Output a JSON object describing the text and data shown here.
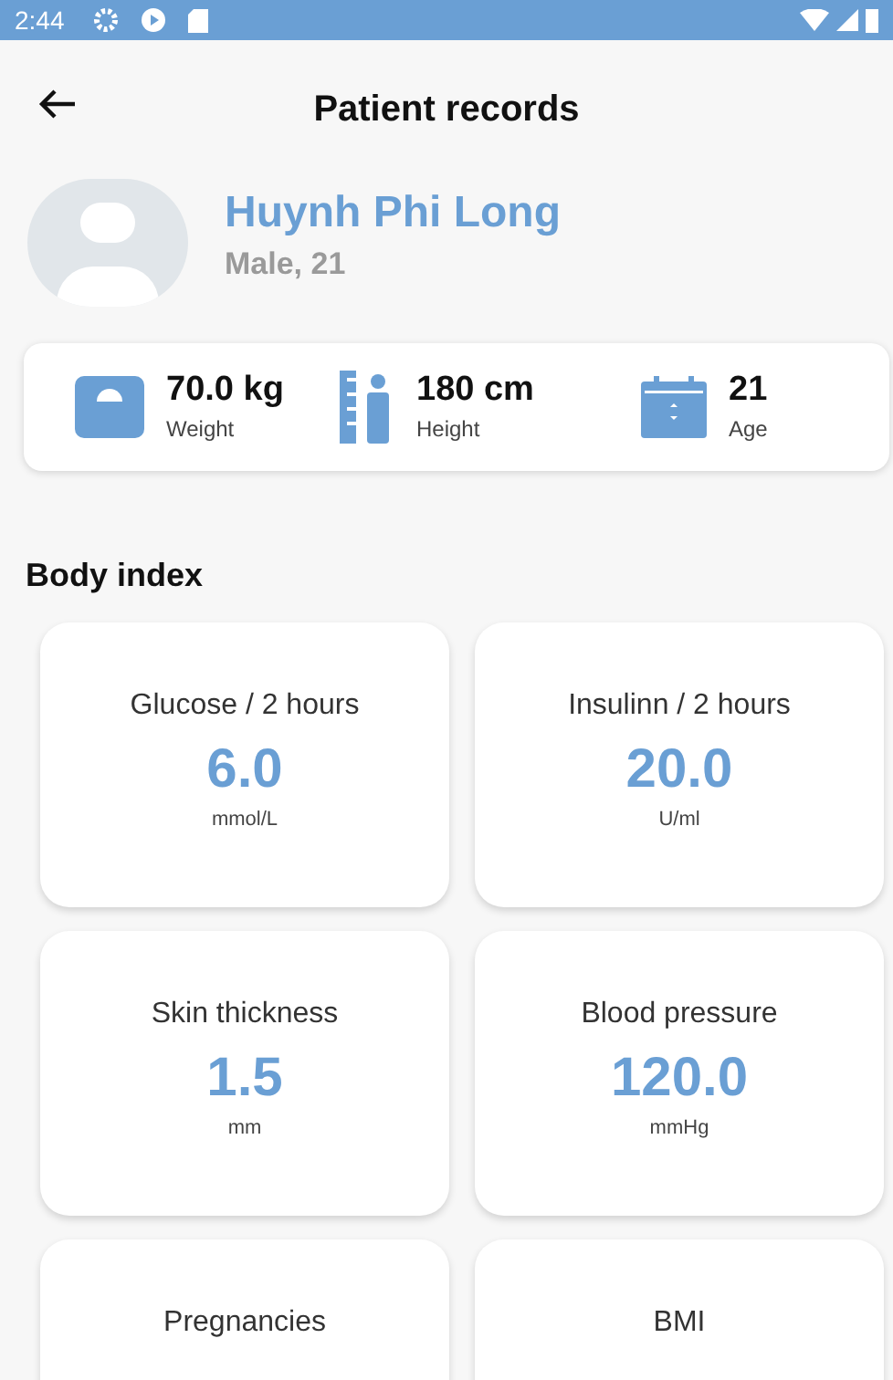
{
  "status_bar": {
    "time": "2:44"
  },
  "header": {
    "title": "Patient records"
  },
  "patient": {
    "name": "Huynh Phi Long",
    "details": "Male, 21"
  },
  "stats": [
    {
      "kind": "weight",
      "value": "70.0 kg",
      "label": "Weight"
    },
    {
      "kind": "height",
      "value": "180 cm",
      "label": "Height"
    },
    {
      "kind": "age",
      "value": "21",
      "label": "Age"
    }
  ],
  "body_index": {
    "title": "Body index",
    "cards": [
      {
        "label": "Glucose / 2 hours",
        "value": "6.0",
        "unit": "mmol/L"
      },
      {
        "label": "Insulinn / 2 hours",
        "value": "20.0",
        "unit": "U/ml"
      },
      {
        "label": "Skin thickness",
        "value": "1.5",
        "unit": "mm"
      },
      {
        "label": "Blood pressure",
        "value": "120.0",
        "unit": "mmHg"
      },
      {
        "label": "Pregnancies"
      },
      {
        "label": "BMI"
      }
    ]
  }
}
